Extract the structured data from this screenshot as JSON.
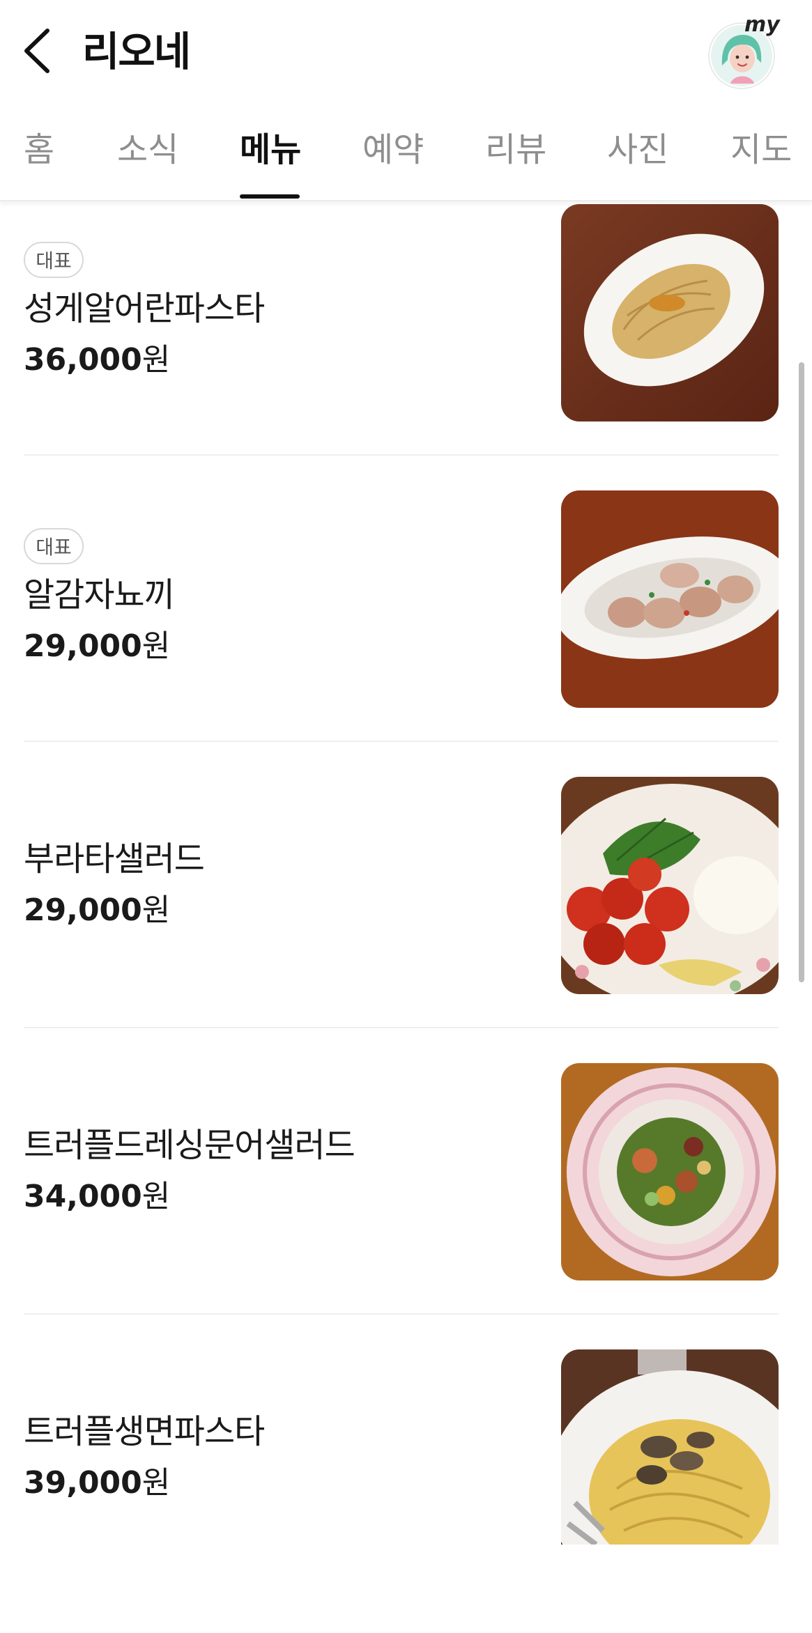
{
  "header": {
    "title": "리오네",
    "back_icon": "chevron-left-icon",
    "avatar_label": "my"
  },
  "tabs": [
    {
      "label": "홈",
      "active": false
    },
    {
      "label": "소식",
      "active": false
    },
    {
      "label": "메뉴",
      "active": true
    },
    {
      "label": "예약",
      "active": false
    },
    {
      "label": "리뷰",
      "active": false
    },
    {
      "label": "사진",
      "active": false
    },
    {
      "label": "지도",
      "active": false
    }
  ],
  "menu": {
    "items": [
      {
        "badge": "대표",
        "name": "성게알어란파스타",
        "price": "36,000",
        "currency": "원"
      },
      {
        "badge": "대표",
        "name": "알감자뇨끼",
        "price": "29,000",
        "currency": "원"
      },
      {
        "name": "부라타샐러드",
        "price": "29,000",
        "currency": "원"
      },
      {
        "name": "트러플드레싱문어샐러드",
        "price": "34,000",
        "currency": "원"
      },
      {
        "name": "트러플생면파스타",
        "price": "39,000",
        "currency": "원"
      }
    ]
  },
  "colors": {
    "text": "#111111",
    "tab_inactive": "#8e8e8e",
    "divider": "#efefef",
    "badge_border": "#d8d8d8"
  }
}
